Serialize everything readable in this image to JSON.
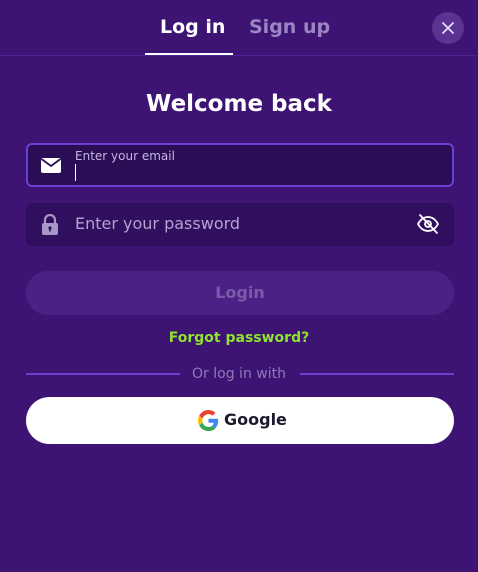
{
  "tabs": {
    "login_label": "Log in",
    "signup_label": "Sign up",
    "active": "Log in"
  },
  "title": "Welcome back",
  "email": {
    "label": "Enter your email",
    "value": "",
    "icon": "mail-icon"
  },
  "password": {
    "placeholder": "Enter your password",
    "value": "",
    "icon": "lock-icon",
    "toggle_icon": "eye-off-icon"
  },
  "login_button": {
    "label": "Login",
    "enabled": false
  },
  "forgot_password": "Forgot password?",
  "divider_text": "Or log in with",
  "google_button": {
    "label": "Google",
    "icon": "google-icon"
  },
  "close_icon": "close-icon",
  "colors": {
    "background": "#3d1473",
    "accent_green": "#8ee32f",
    "input_border": "#6b3fd0"
  }
}
